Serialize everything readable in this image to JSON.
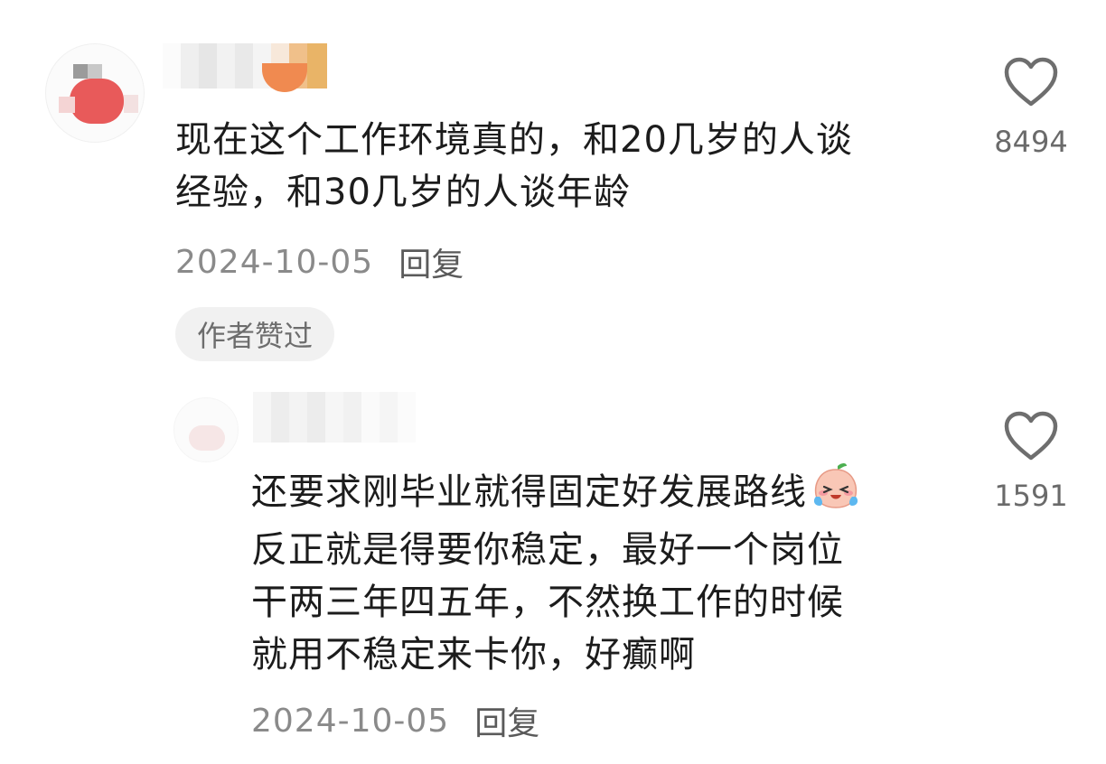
{
  "comments": [
    {
      "text_lines": [
        "现在这个工作环境真的，和20几岁的人谈",
        "经验，和30几岁的人谈年龄"
      ],
      "date": "2024-10-05",
      "reply_label": "回复",
      "badge": "作者赞过",
      "like_count": "8494",
      "like_icon": "heart-outline-icon"
    },
    {
      "text_lines": [
        "还要求刚毕业就得固定好发展路线",
        "反正就是得要你稳定，最好一个岗位",
        "干两三年四五年，不然换工作的时候",
        "就用不稳定来卡你，好癫啊"
      ],
      "emoji": "crying-face-sticker",
      "date": "2024-10-05",
      "reply_label": "回复",
      "like_count": "1591",
      "like_icon": "heart-outline-icon"
    }
  ],
  "colors": {
    "text": "#1c1c1c",
    "meta": "#8a8a8a",
    "badge_bg": "#f1f1f1",
    "icon": "#6e6e6e"
  }
}
